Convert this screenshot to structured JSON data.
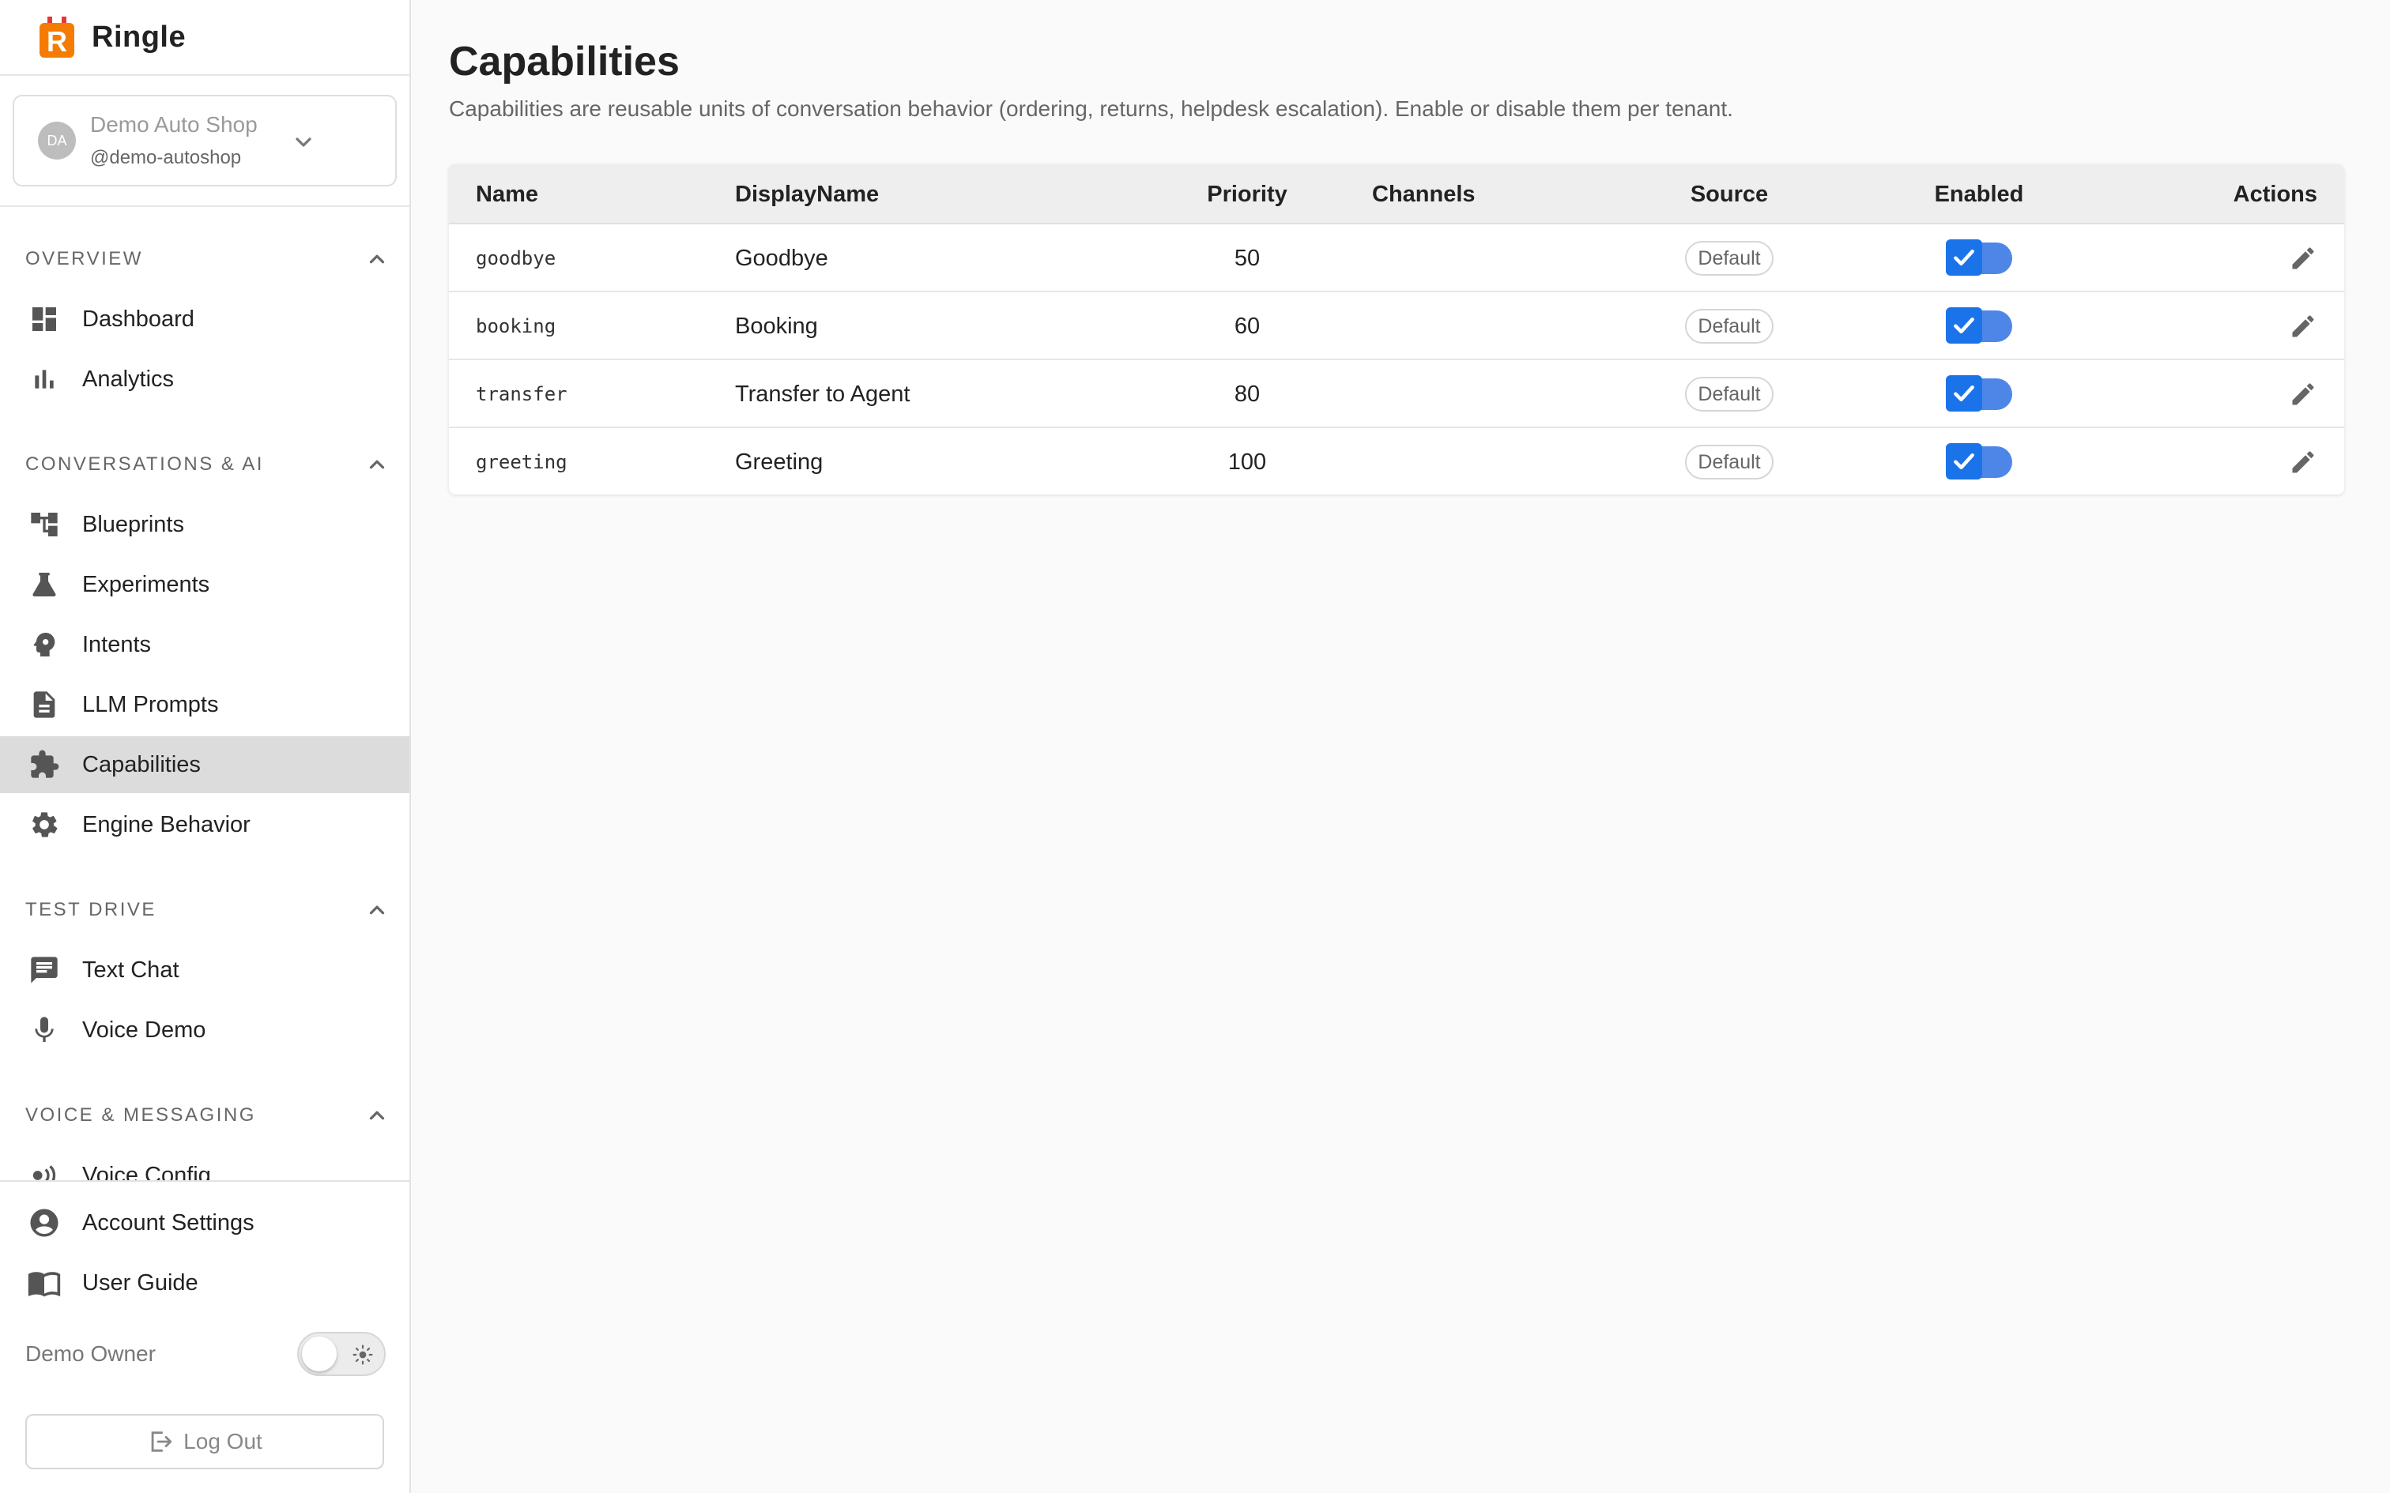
{
  "brand": {
    "name": "Ringle",
    "logo_letter": "R"
  },
  "tenant": {
    "initials": "DA",
    "name": "Demo Auto Shop",
    "handle": "@demo-autoshop"
  },
  "sections": [
    {
      "title": "OVERVIEW",
      "items": [
        {
          "label": "Dashboard",
          "icon": "dashboard-icon"
        },
        {
          "label": "Analytics",
          "icon": "bar-chart-icon"
        }
      ]
    },
    {
      "title": "CONVERSATIONS & AI",
      "items": [
        {
          "label": "Blueprints",
          "icon": "account-tree-icon"
        },
        {
          "label": "Experiments",
          "icon": "flask-icon"
        },
        {
          "label": "Intents",
          "icon": "psychology-icon"
        },
        {
          "label": "LLM Prompts",
          "icon": "document-icon"
        },
        {
          "label": "Capabilities",
          "icon": "puzzle-icon",
          "active": true
        },
        {
          "label": "Engine Behavior",
          "icon": "gear-icon"
        }
      ]
    },
    {
      "title": "TEST DRIVE",
      "items": [
        {
          "label": "Text Chat",
          "icon": "chat-icon"
        },
        {
          "label": "Voice Demo",
          "icon": "microphone-icon"
        }
      ]
    },
    {
      "title": "VOICE & MESSAGING",
      "items": [
        {
          "label": "Voice Config",
          "icon": "speaker-waves-icon"
        }
      ]
    }
  ],
  "bottom": {
    "account_settings": "Account Settings",
    "user_guide": "User Guide",
    "owner": "Demo Owner",
    "logout": "Log Out"
  },
  "page": {
    "title": "Capabilities",
    "subtitle": "Capabilities are reusable units of conversation behavior (ordering, returns, helpdesk escalation). Enable or disable them per tenant."
  },
  "table": {
    "headers": {
      "name": "Name",
      "display": "DisplayName",
      "priority": "Priority",
      "channels": "Channels",
      "source": "Source",
      "enabled": "Enabled",
      "actions": "Actions"
    },
    "rows": [
      {
        "name": "goodbye",
        "display": "Goodbye",
        "priority": "50",
        "channels": "",
        "source": "Default",
        "enabled": true
      },
      {
        "name": "booking",
        "display": "Booking",
        "priority": "60",
        "channels": "",
        "source": "Default",
        "enabled": true
      },
      {
        "name": "transfer",
        "display": "Transfer to Agent",
        "priority": "80",
        "channels": "",
        "source": "Default",
        "enabled": true
      },
      {
        "name": "greeting",
        "display": "Greeting",
        "priority": "100",
        "channels": "",
        "source": "Default",
        "enabled": true
      }
    ]
  },
  "colors": {
    "accent": "#1a73e8",
    "switch_track": "#4e86e8",
    "logo_orange": "#f57c00",
    "active_bg": "#dcdcdc"
  }
}
